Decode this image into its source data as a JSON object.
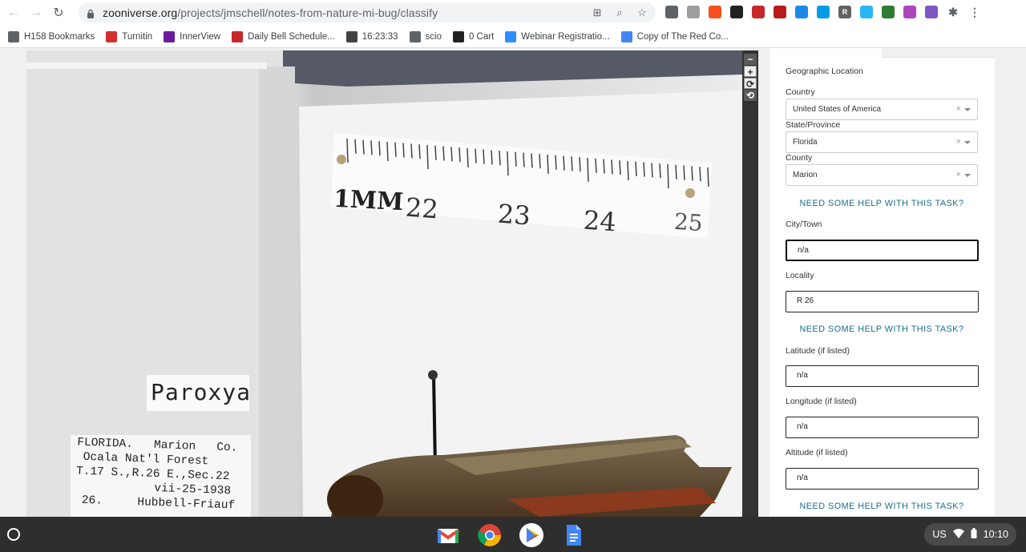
{
  "browser": {
    "url_domain": "zooniverse.org",
    "url_path": "/projects/jmschell/notes-from-nature-mi-bug/classify"
  },
  "bookmarks": [
    {
      "label": "H158 Bookmarks",
      "icon": "folder-icon",
      "color": "#5f6368"
    },
    {
      "label": "Turnitin",
      "icon": "turnitin-icon",
      "color": "#d32f2f"
    },
    {
      "label": "InnerView",
      "icon": "innerview-icon",
      "color": "#6a1b9a"
    },
    {
      "label": "Daily Bell Schedule...",
      "icon": "bell-icon",
      "color": "#c62828"
    },
    {
      "label": "16:23:33",
      "icon": "clock-icon",
      "color": "#424242"
    },
    {
      "label": "scio",
      "icon": "folder-icon",
      "color": "#5f6368"
    },
    {
      "label": "0 Cart",
      "icon": "amazon-icon",
      "color": "#212121"
    },
    {
      "label": "Webinar Registratio...",
      "icon": "zoom-icon",
      "color": "#2d8cff"
    },
    {
      "label": "Copy of The Red Co...",
      "icon": "docs-icon",
      "color": "#4285f4"
    }
  ],
  "specimen": {
    "genus_label": "Paroxya",
    "collection_lines": [
      "FLORIDA.   Marion   Co.",
      "Ocala Nat'l Forest",
      "T.17 S.,R.26 E.,Sec.22",
      "vii-25-1938",
      "26.     Hubbell-Friauf"
    ],
    "ruler_labels": [
      "1MM",
      "22",
      "23",
      "24",
      "25"
    ]
  },
  "zoom": {
    "zoom_out": "−",
    "zoom_in": "+",
    "rotate": "⟳",
    "reset": "⟲"
  },
  "form": {
    "section_title": "Geographic Location",
    "country": {
      "label": "Country",
      "value": "United States of America"
    },
    "state": {
      "label": "State/Province",
      "value": "Florida"
    },
    "county": {
      "label": "County",
      "value": "Marion"
    },
    "help_text": "NEED SOME HELP WITH THIS TASK?",
    "city": {
      "label": "City/Town",
      "value": "n/a"
    },
    "locality": {
      "label": "Locality",
      "value": "R 26"
    },
    "latitude": {
      "label": "Latitude (if listed)",
      "value": "n/a"
    },
    "longitude": {
      "label": "Longitude (if listed)",
      "value": "n/a"
    },
    "altitude": {
      "label": "Altitude (if listed)",
      "value": "n/a"
    },
    "clear_symbol": "×"
  },
  "shelf": {
    "locale": "US",
    "time": "10:10"
  }
}
